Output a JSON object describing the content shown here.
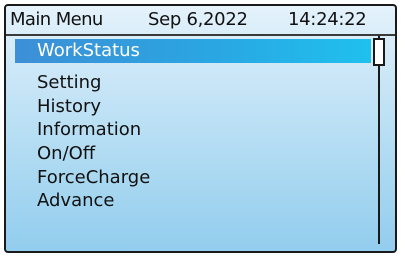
{
  "header": {
    "title": "Main Menu",
    "date": "Sep 6,2022",
    "time": "14:24:22"
  },
  "menu": {
    "selected_index": 0,
    "items": [
      {
        "label": "WorkStatus"
      },
      {
        "label": "Setting"
      },
      {
        "label": "History"
      },
      {
        "label": "Information"
      },
      {
        "label": "On/Off"
      },
      {
        "label": "ForceCharge"
      },
      {
        "label": "Advance"
      }
    ]
  },
  "colors": {
    "selection": "#2aa6e2",
    "background": "#c9e6f7",
    "border": "#1a1a1a"
  }
}
